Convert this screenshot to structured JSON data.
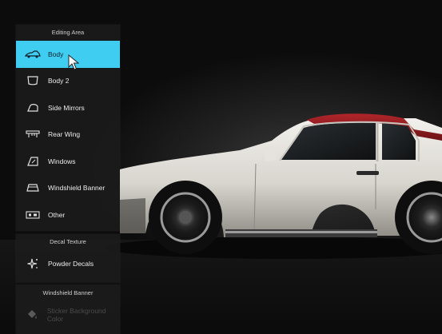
{
  "editing_area": {
    "header": "Editing Area",
    "items": [
      {
        "label": "Body",
        "icon": "car-body-icon",
        "active": true
      },
      {
        "label": "Body 2",
        "icon": "body-panel-icon",
        "active": false
      },
      {
        "label": "Side Mirrors",
        "icon": "side-mirror-icon",
        "active": false
      },
      {
        "label": "Rear Wing",
        "icon": "rear-wing-icon",
        "active": false
      },
      {
        "label": "Windows",
        "icon": "window-icon",
        "active": false
      },
      {
        "label": "Windshield Banner",
        "icon": "windshield-icon",
        "active": false
      },
      {
        "label": "Other",
        "icon": "license-plate-icon",
        "active": false
      }
    ]
  },
  "decal_texture": {
    "header": "Decal Texture",
    "items": [
      {
        "label": "Powder Decals",
        "icon": "sparkle-icon"
      }
    ]
  },
  "windshield_banner": {
    "header": "Windshield Banner",
    "items": [
      {
        "label": "Sticker Background Color",
        "icon": "paint-bucket-icon"
      }
    ]
  },
  "colors": {
    "accent": "#3fcdf2",
    "car_body": "#dcdad6",
    "car_roof": "#8c1a1d"
  }
}
